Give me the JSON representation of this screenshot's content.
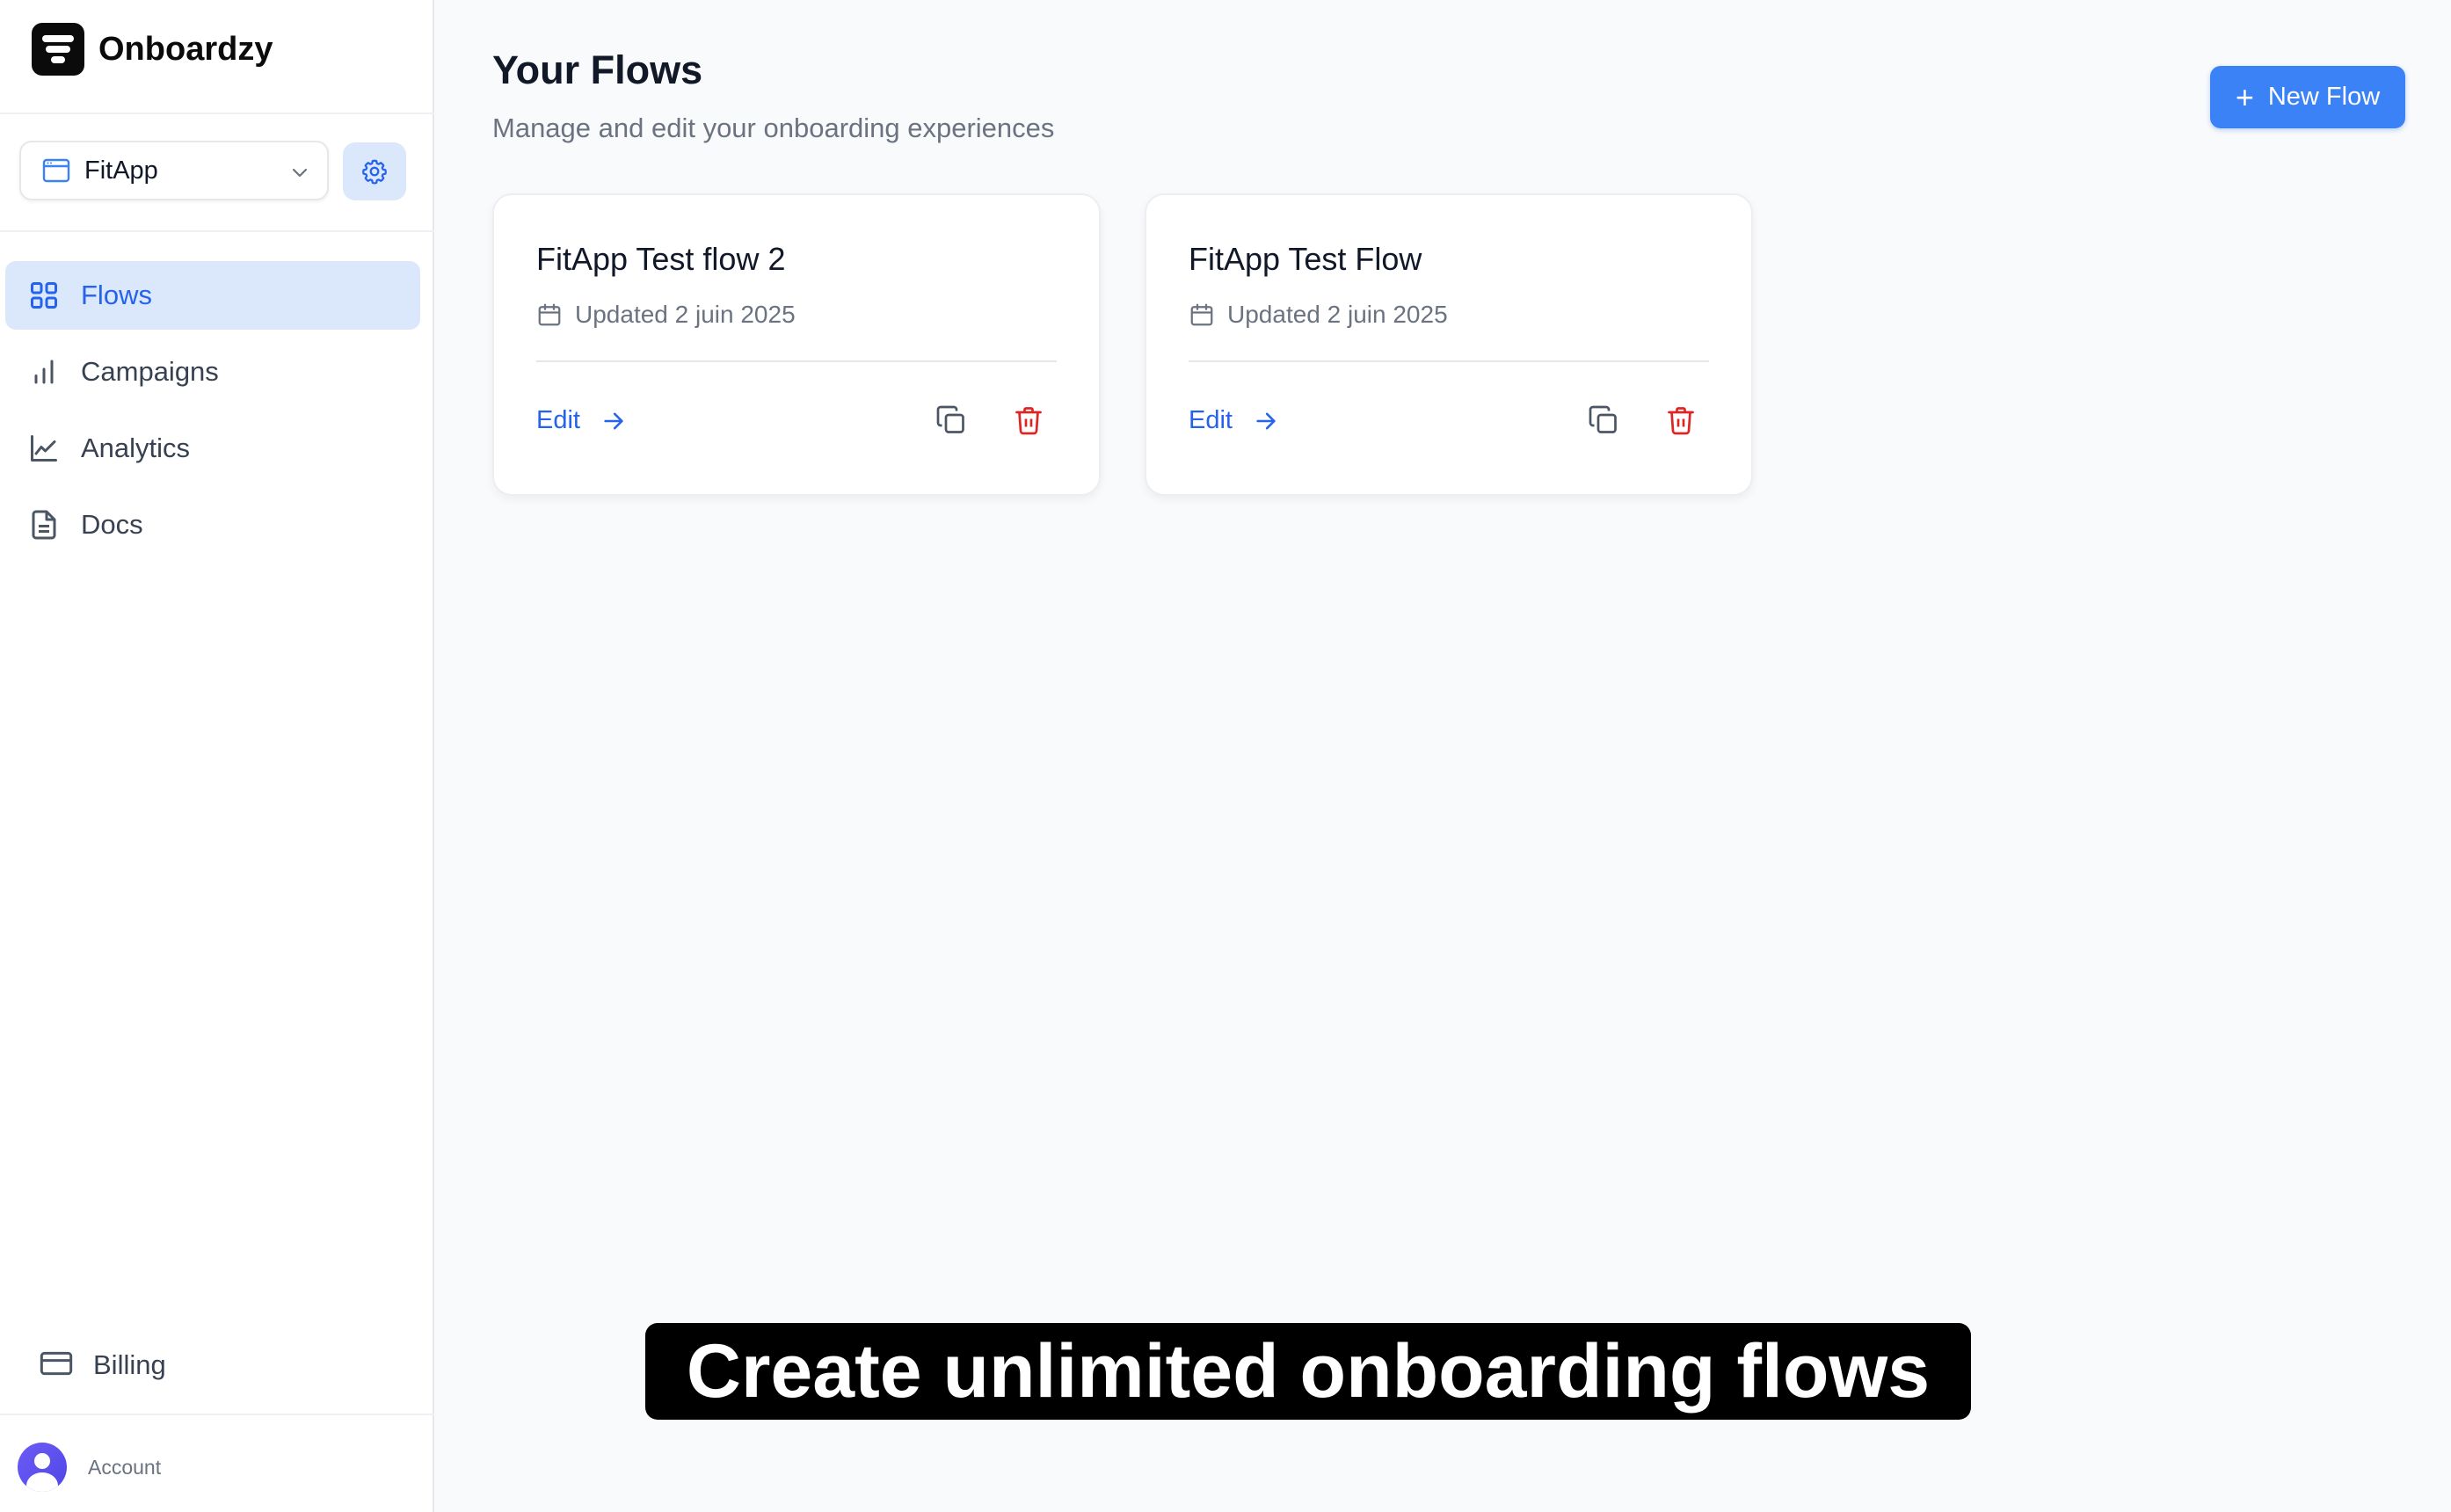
{
  "brand": {
    "name": "Onboardzy"
  },
  "app_selector": {
    "value": "FitApp"
  },
  "sidebar": {
    "items": [
      {
        "label": "Flows",
        "active": true
      },
      {
        "label": "Campaigns",
        "active": false
      },
      {
        "label": "Analytics",
        "active": false
      },
      {
        "label": "Docs",
        "active": false
      }
    ],
    "billing": "Billing",
    "account": "Account"
  },
  "header": {
    "title": "Your Flows",
    "subtitle": "Manage and edit your onboarding experiences",
    "new_flow_label": "New Flow"
  },
  "flows": [
    {
      "title": "FitApp Test flow 2",
      "updated": "Updated 2 juin 2025",
      "edit_label": "Edit"
    },
    {
      "title": "FitApp Test Flow",
      "updated": "Updated 2 juin 2025",
      "edit_label": "Edit"
    }
  ],
  "caption": "Create unlimited onboarding flows",
  "colors": {
    "accent": "#3b82f6",
    "active_nav_bg": "#dbe7fb",
    "delete": "#dc2626"
  }
}
